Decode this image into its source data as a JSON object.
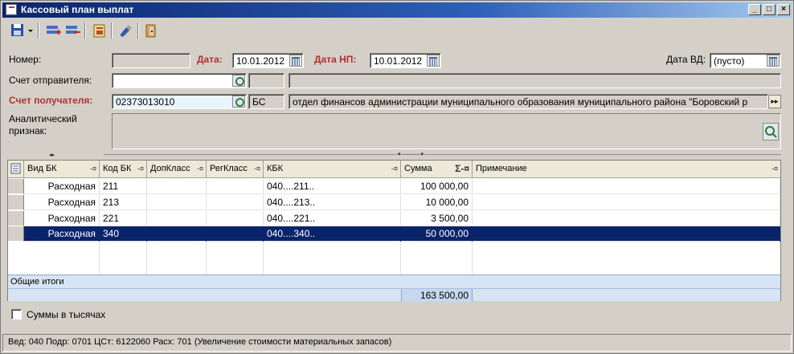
{
  "window": {
    "title": "Кассовый план выплат"
  },
  "form": {
    "nomer_label": "Номер:",
    "nomer_value": "",
    "data_label": "Дата:",
    "data_value": "10.01.2012",
    "data_np_label": "Дата НП:",
    "data_np_value": "10.01.2012",
    "data_vd_label": "Дата ВД:",
    "data_vd_value": "(пусто)",
    "schet_otpr_label": "Счет отправителя:",
    "schet_otpr_value": "",
    "schet_otpr_code": "",
    "schet_otpr_name": "",
    "schet_pol_label": "Счет получателя:",
    "schet_pol_value": "02373013010",
    "schet_pol_code": "БС",
    "schet_pol_name": "отдел финансов администрации муниципального образования муниципального района \"Боровский р",
    "analit_label_1": "Аналитический",
    "analit_label_2": "признак:"
  },
  "grid": {
    "columns": [
      "Вид БК",
      "Код БК",
      "ДопКласс",
      "РегКласс",
      "КБК",
      "Сумма",
      "Примечание"
    ],
    "rows": [
      {
        "vid_bk": "Расходная",
        "kod_bk": "211",
        "dopklass": "",
        "regklass": "",
        "kbk": "040....211..",
        "summa": "100 000,00",
        "primechanie": ""
      },
      {
        "vid_bk": "Расходная",
        "kod_bk": "213",
        "dopklass": "",
        "regklass": "",
        "kbk": "040....213..",
        "summa": "10 000,00",
        "primechanie": ""
      },
      {
        "vid_bk": "Расходная",
        "kod_bk": "221",
        "dopklass": "",
        "regklass": "",
        "kbk": "040....221..",
        "summa": "3 500,00",
        "primechanie": ""
      },
      {
        "vid_bk": "Расходная",
        "kod_bk": "340",
        "dopklass": "",
        "regklass": "",
        "kbk": "040....340..",
        "summa": "50 000,00",
        "primechanie": ""
      }
    ],
    "totals_label": "Общие итоги",
    "totals_sum": "163 500,00"
  },
  "options": {
    "thousands_label": "Суммы в тысячах"
  },
  "status": {
    "text": "Вед: 040 Подр: 0701 ЦСт: 6122060 Расх: 701 (Увеличение стоимости материальных запасов)"
  },
  "colors": {
    "title_bar": "#0a246a",
    "selected_row": "#0a246a",
    "required_label": "#b03030",
    "totals_bg": "#d6e4f4"
  },
  "icons": [
    "save-icon",
    "dropdown-arrow-icon",
    "add-row-icon",
    "delete-row-icon",
    "report-icon",
    "tool-icon",
    "exit-icon",
    "calendar-icon",
    "lookup-icon",
    "sigma-icon",
    "pin-icon",
    "expand-icon"
  ]
}
